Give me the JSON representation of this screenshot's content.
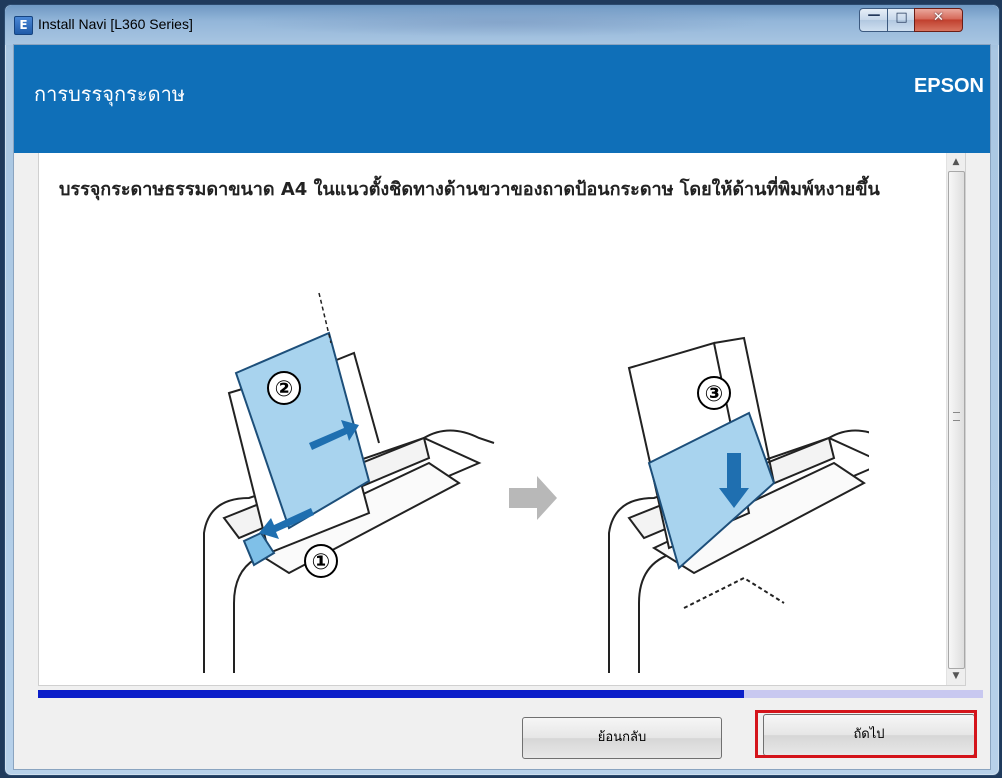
{
  "window": {
    "title": "Install Navi [L360 Series]",
    "app_icon_letter": "E",
    "icon": "epson-app-icon",
    "controls": {
      "minimize_glyph": "—",
      "maximize_glyph": "□",
      "close_glyph": "✕"
    }
  },
  "header": {
    "title": "การบรรจุกระดาษ",
    "brand": "EPSON",
    "background_color": "#0f6fb8"
  },
  "content": {
    "instruction": "บรรจุกระดาษธรรมดาขนาด A4 ในแนวตั้งชิดทางด้านขวาของถาดป้อนกระดาษ โดยให้ด้านที่พิมพ์หงายขึ้น",
    "steps": [
      "①",
      "②",
      "③"
    ]
  },
  "progress": {
    "fraction": 0.747,
    "fill_color": "#0b1ec9",
    "track_color": "#c8c8f0"
  },
  "buttons": {
    "back_label": "ย้อนกลับ",
    "next_label": "ถัดไป",
    "highlight_color": "#d4141b"
  }
}
